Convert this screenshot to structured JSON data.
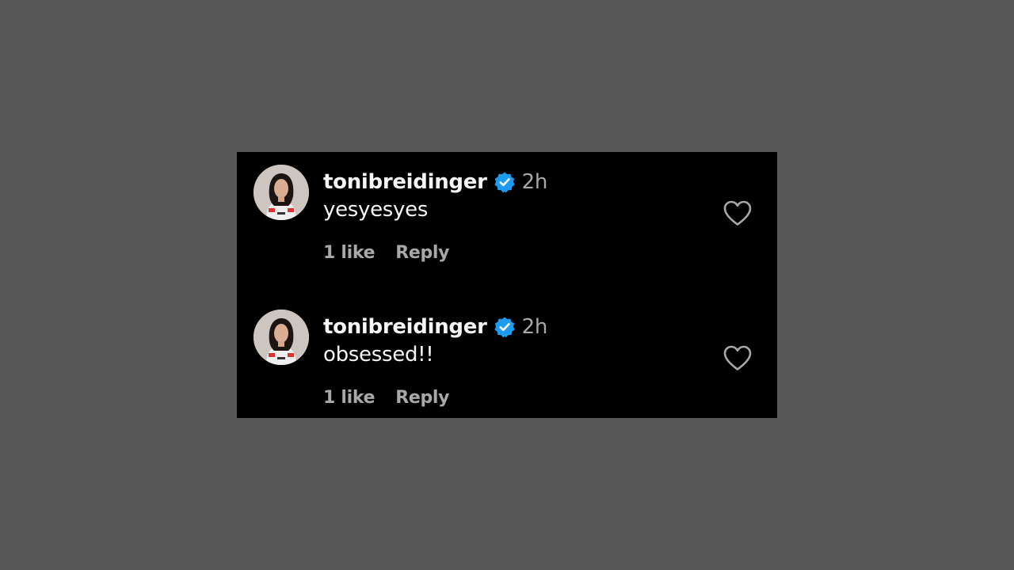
{
  "comments": [
    {
      "username": "tonibreidinger",
      "time": "2h",
      "text": "yesyesyes",
      "likes": "1 like",
      "reply_label": "Reply",
      "verified": true
    },
    {
      "username": "tonibreidinger",
      "time": "2h",
      "text": "obsessed!!",
      "likes": "1 like",
      "reply_label": "Reply",
      "verified": true
    }
  ],
  "icons": {
    "verified": "verified-badge-icon",
    "like": "heart-icon"
  },
  "colors": {
    "background": "#585858",
    "panel": "#000000",
    "primary_text": "#f5f5f5",
    "secondary_text": "#a8a8a8",
    "verified_blue": "#1d9bf0"
  }
}
